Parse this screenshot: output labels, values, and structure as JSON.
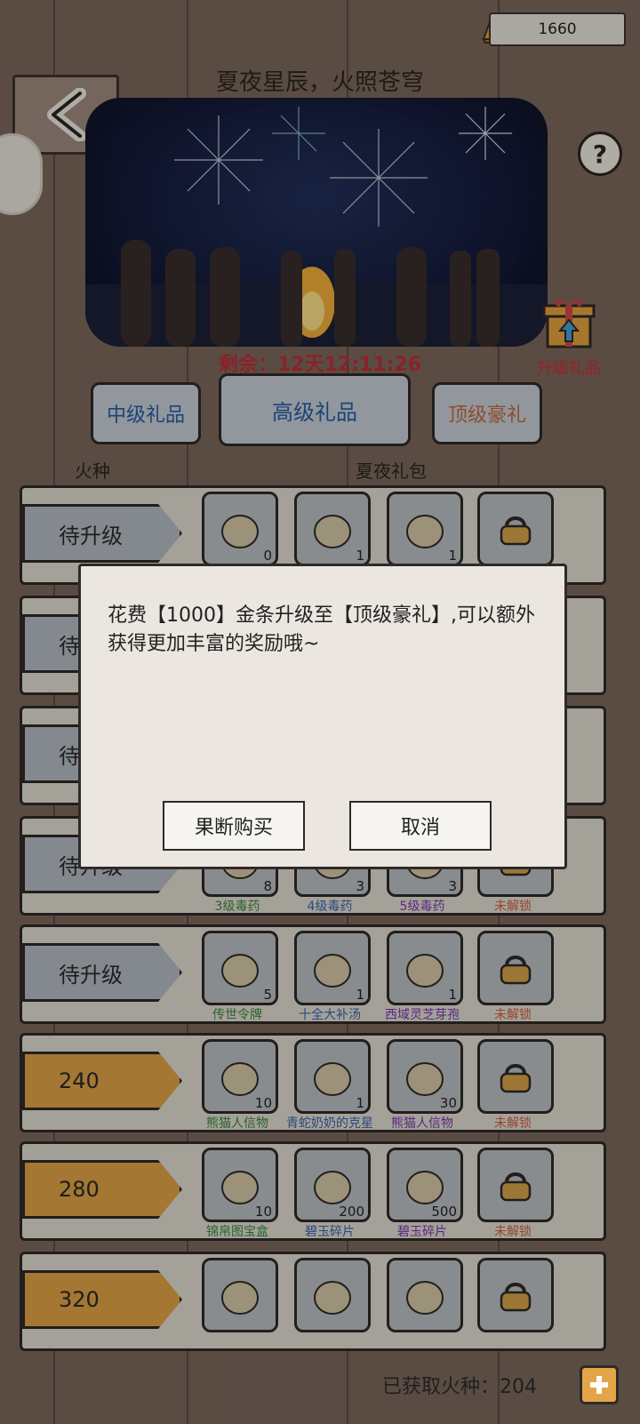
{
  "currency": {
    "amount": "1660",
    "icon": "gold-bar-icon"
  },
  "event": {
    "title": "夏夜星辰，火照苍穹",
    "timer": "剩余：12天12:11:26"
  },
  "side": {
    "help": "?",
    "upgrade_gift_label": "升级礼品"
  },
  "tabs": [
    {
      "label": "中级礼品",
      "color": "#2a5ea8"
    },
    {
      "label": "高级礼品",
      "color": "#2a5ea8"
    },
    {
      "label": "顶级豪礼",
      "color": "#c86a3c"
    }
  ],
  "columns": {
    "left": "火种",
    "right": "夏夜礼包"
  },
  "rows": [
    {
      "level": "待升级",
      "gold": false,
      "items": [
        {
          "label": "",
          "count": "0"
        },
        {
          "label": "",
          "count": "1"
        },
        {
          "label": "",
          "count": "1"
        },
        {
          "label": "",
          "count": "",
          "locked": true
        }
      ]
    },
    {
      "level": "待升级",
      "gold": false,
      "items": [
        {
          "label": "",
          "count": ""
        },
        {
          "label": "",
          "count": ""
        },
        {
          "label": "",
          "count": ""
        },
        {
          "label": "",
          "count": "",
          "locked": true
        }
      ]
    },
    {
      "level": "待升级",
      "gold": false,
      "items": [
        {
          "label": "",
          "count": ""
        },
        {
          "label": "",
          "count": ""
        },
        {
          "label": "",
          "count": ""
        },
        {
          "label": "",
          "count": "",
          "locked": true
        }
      ]
    },
    {
      "level": "待升级",
      "gold": false,
      "items": [
        {
          "label": "3级毒药",
          "count": "8"
        },
        {
          "label": "4级毒药",
          "count": "3"
        },
        {
          "label": "5级毒药",
          "count": "3"
        },
        {
          "label": "未解锁",
          "count": "",
          "locked": true
        }
      ]
    },
    {
      "level": "待升级",
      "gold": false,
      "items": [
        {
          "label": "传世令牌",
          "count": "5"
        },
        {
          "label": "十全大补汤",
          "count": "1"
        },
        {
          "label": "西域灵芝芽孢",
          "count": "1"
        },
        {
          "label": "未解锁",
          "count": "",
          "locked": true
        }
      ]
    },
    {
      "level": "240",
      "gold": true,
      "items": [
        {
          "label": "熊猫人信物",
          "count": "10"
        },
        {
          "label": "青蛇奶奶的克星",
          "count": "1"
        },
        {
          "label": "熊猫人信物",
          "count": "30"
        },
        {
          "label": "未解锁",
          "count": "",
          "locked": true
        }
      ]
    },
    {
      "level": "280",
      "gold": true,
      "items": [
        {
          "label": "锦帛图宝盒",
          "count": "10"
        },
        {
          "label": "碧玉碎片",
          "count": "200"
        },
        {
          "label": "碧玉碎片",
          "count": "500"
        },
        {
          "label": "未解锁",
          "count": "",
          "locked": true
        }
      ]
    },
    {
      "level": "320",
      "gold": true,
      "items": [
        {
          "label": "",
          "count": ""
        },
        {
          "label": "",
          "count": ""
        },
        {
          "label": "",
          "count": ""
        },
        {
          "label": "",
          "count": "",
          "locked": true
        }
      ]
    }
  ],
  "colors": {
    "label_green": "#3a8a3a",
    "label_blue": "#3a63b0",
    "label_purple": "#7a3ab0",
    "label_locked": "#d06040"
  },
  "dialog": {
    "message": "花费【1000】金条升级至【顶级豪礼】,可以额外获得更加丰富的奖励哦~",
    "confirm": "果断购买",
    "cancel": "取消"
  },
  "footer": {
    "obtained": "已获取火种：204"
  }
}
